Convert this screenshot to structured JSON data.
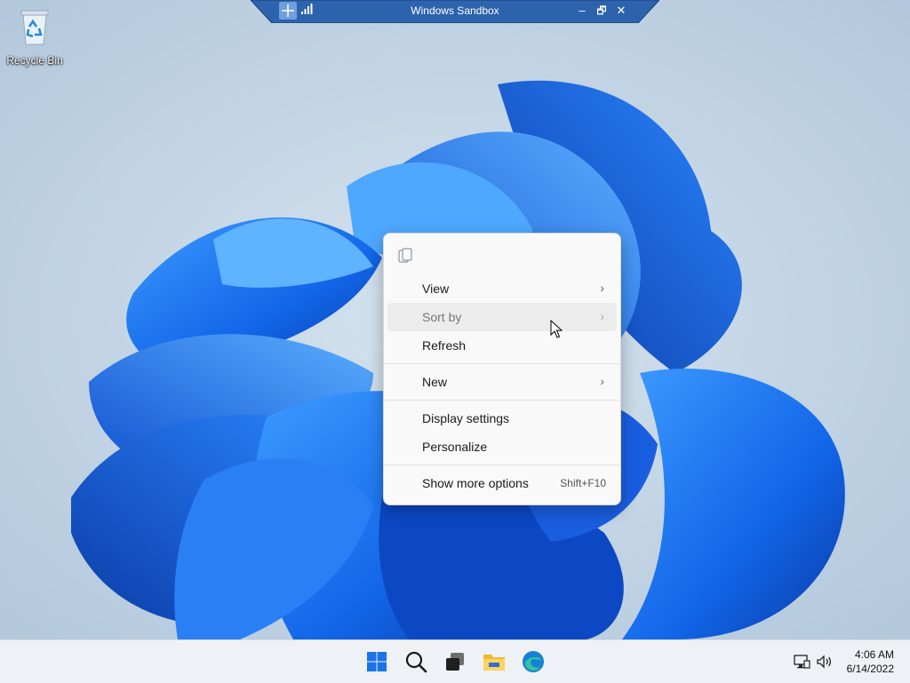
{
  "sandbox_bar": {
    "title": "Windows Sandbox",
    "minimize": "–",
    "restore": "🗗",
    "close": "✕"
  },
  "desktop_icons": [
    {
      "label": "Recycle Bin",
      "icon": "recycle-bin-icon"
    }
  ],
  "context_menu": {
    "top_icon": "copy-icon",
    "items": [
      {
        "label": "View",
        "submenu": true
      },
      {
        "label": "Sort by",
        "submenu": true,
        "state": "hover"
      },
      {
        "label": "Refresh"
      },
      {
        "label": "New",
        "submenu": true
      },
      {
        "label": "Display settings"
      },
      {
        "label": "Personalize"
      },
      {
        "label": "Show more options",
        "shortcut": "Shift+F10"
      }
    ],
    "chevron": "›"
  },
  "taskbar": {
    "icons": [
      "start-icon",
      "search-icon",
      "task-view-icon",
      "file-explorer-icon",
      "edge-icon"
    ],
    "tray": [
      "network-icon",
      "volume-icon"
    ],
    "time": "4:06 AM",
    "date": "6/14/2022"
  },
  "colors": {
    "accent": "#0067c0",
    "bloom_dark": "#0a3fb5",
    "bloom_light": "#2f8cff",
    "sandbox_bar": "#2b5fa8"
  }
}
